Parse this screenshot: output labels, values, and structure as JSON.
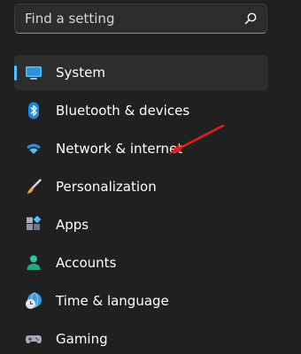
{
  "search": {
    "placeholder": "Find a setting",
    "icon": "search-icon"
  },
  "sidebar": {
    "accent_color": "#4cc2ff",
    "items": [
      {
        "label": "System",
        "icon": "system-monitor-icon",
        "selected": true
      },
      {
        "label": "Bluetooth & devices",
        "icon": "bluetooth-icon",
        "selected": false
      },
      {
        "label": "Network & internet",
        "icon": "wifi-icon",
        "selected": false
      },
      {
        "label": "Personalization",
        "icon": "paintbrush-icon",
        "selected": false
      },
      {
        "label": "Apps",
        "icon": "apps-icon",
        "selected": false
      },
      {
        "label": "Accounts",
        "icon": "person-icon",
        "selected": false
      },
      {
        "label": "Time & language",
        "icon": "globe-clock-icon",
        "selected": false
      },
      {
        "label": "Gaming",
        "icon": "gamepad-icon",
        "selected": false
      }
    ]
  },
  "annotation": {
    "arrow_color": "#e0201b"
  }
}
